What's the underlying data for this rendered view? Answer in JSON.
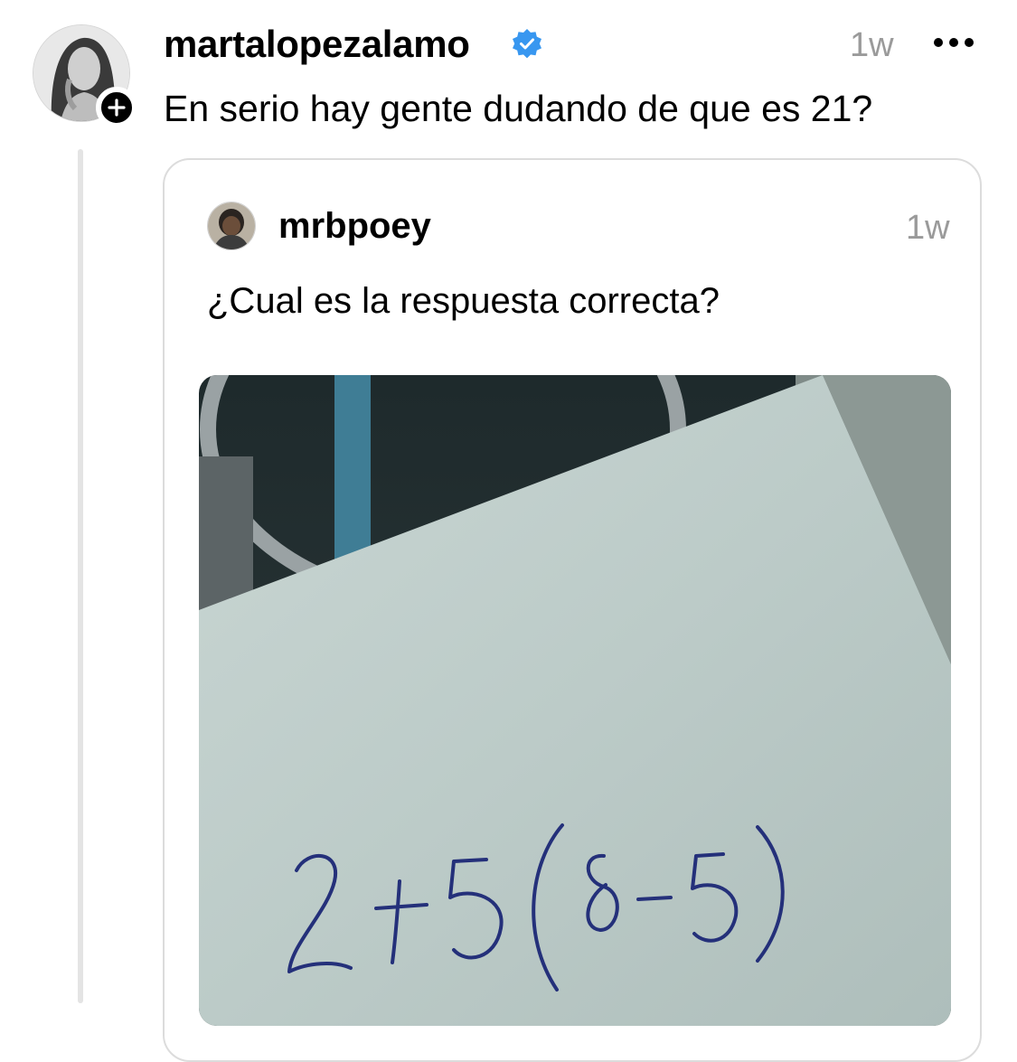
{
  "post": {
    "username": "martalopezalamo",
    "time": "1w",
    "text": "En serio hay gente dudando de que es 21?"
  },
  "quoted_post": {
    "username": "mrbpoey",
    "time": "1w",
    "text": "¿Cual es la respuesta correcta?",
    "image_handwriting": "2+5(8-5)"
  },
  "icons": {
    "verified": "verified-badge-icon",
    "follow": "plus-icon",
    "more": "more-horizontal-icon"
  },
  "colors": {
    "verified_blue": "#3897f0",
    "secondary_text": "#9a9a9a"
  }
}
